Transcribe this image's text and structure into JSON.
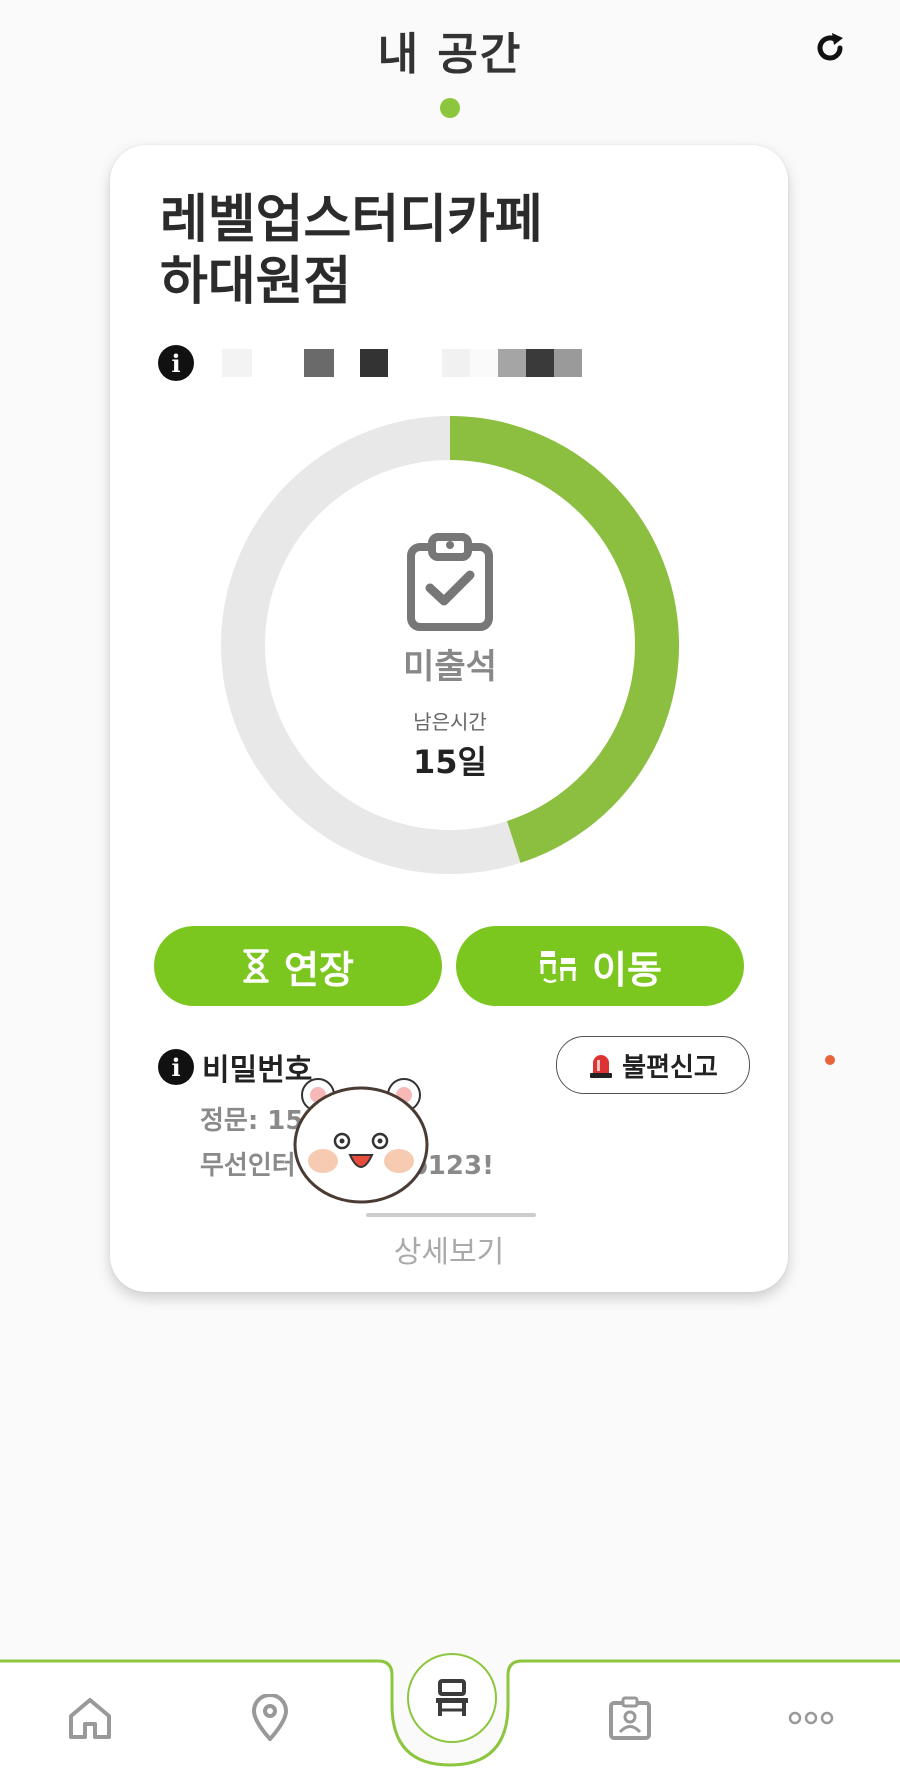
{
  "header": {
    "title": "내 공간",
    "refresh_icon": "refresh-icon"
  },
  "card": {
    "store_name_line1": "레벨업스터디카페",
    "store_name_line2": "하대원점",
    "info_icon": "info-icon",
    "status": {
      "label": "미출석",
      "remaining_label": "남은시간",
      "remaining_value": "15일",
      "progress_fraction": 0.45,
      "icon": "clipboard-check-icon"
    },
    "buttons": {
      "extend": {
        "label": "연장",
        "icon": "hourglass-icon"
      },
      "move": {
        "label": "이동",
        "icon": "seat-move-icon"
      }
    },
    "password": {
      "title": "비밀번호",
      "line1": "정문: 15",
      "line2_prefix": "무선인터",
      "line2_suffix": "up123!"
    },
    "report_button": {
      "label": "불편신고",
      "icon": "siren-icon"
    },
    "detail_link": "상세보기"
  },
  "nav": {
    "items": [
      {
        "icon": "home-icon"
      },
      {
        "icon": "map-pin-icon"
      },
      {
        "icon": "seat-icon"
      },
      {
        "icon": "id-badge-icon"
      },
      {
        "icon": "more-icon"
      }
    ]
  },
  "colors": {
    "accent": "#7cc620",
    "ring_fill": "#8cbf3f",
    "ring_track": "#e8e8e8",
    "alert_dot": "#e8643c"
  }
}
